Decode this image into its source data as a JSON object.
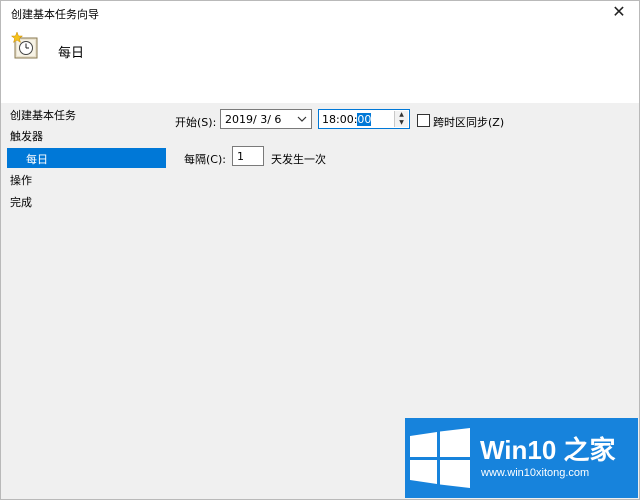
{
  "window": {
    "title": "创建基本任务向导",
    "close_label": "✕"
  },
  "header": {
    "icon": "calendar-clock-icon",
    "title": "每日"
  },
  "nav": {
    "items": [
      {
        "label": "创建基本任务"
      },
      {
        "label": "触发器"
      },
      {
        "label": "每日",
        "selected": true
      },
      {
        "label": "操作"
      },
      {
        "label": "完成"
      }
    ]
  },
  "form": {
    "start_label": "开始(S):",
    "start_date": "2019/ 3/ 6",
    "start_time_prefix": "18:00:",
    "start_time_selected": "00",
    "sync_label": "跨时区同步(Z)",
    "sync_checked": false,
    "interval_label": "每隔(C):",
    "interval_value": "1",
    "interval_suffix": "天发生一次"
  },
  "watermark": {
    "title": "Win10 之家",
    "url": "www.win10xitong.com",
    "icon": "windows-logo-icon",
    "color": "#1783dc"
  }
}
